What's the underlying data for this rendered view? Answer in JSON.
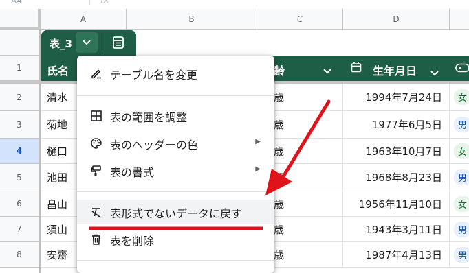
{
  "formula_bar": {
    "cell_ref": "A4",
    "fx": "fx"
  },
  "columns": [
    "A",
    "B",
    "C",
    "D",
    ""
  ],
  "rows": [
    "1",
    "2",
    "3",
    "4",
    "5",
    "6",
    "7",
    "8"
  ],
  "selected_row": "4",
  "table": {
    "name": "表_3",
    "headers": {
      "name": "氏名",
      "age": "齢",
      "birthday": "生年月日"
    },
    "data": [
      {
        "name": "清水 ",
        "age": "歳",
        "birthday": "1994年7月24日",
        "gender": "女",
        "gender_type": "f"
      },
      {
        "name": "菊地 ",
        "age": "歳",
        "birthday": "1977年6月5日",
        "gender": "男",
        "gender_type": "m"
      },
      {
        "name": "樋口 ",
        "age": "歳",
        "birthday": "1963年10月7日",
        "gender": "女",
        "gender_type": "f"
      },
      {
        "name": "池田 ",
        "age": "歳",
        "birthday": "1968年8月23日",
        "gender": "男",
        "gender_type": "m"
      },
      {
        "name": "畠山 ",
        "age": "歳",
        "birthday": "1956年11月10日",
        "gender": "女",
        "gender_type": "f"
      },
      {
        "name": "須山 ",
        "age": "歳",
        "birthday": "1943年3月11日",
        "gender": "男",
        "gender_type": "m"
      },
      {
        "name": "安齋 ",
        "age": "歳",
        "birthday": "1987年4月13日",
        "gender": "男",
        "gender_type": "m"
      }
    ]
  },
  "menu": {
    "rename": "テーブル名を変更",
    "adjust_range": "表の範囲を調整",
    "header_color": "表のヘッダーの色",
    "format": "表の書式",
    "revert": "表形式でないデータに戻す",
    "delete": "表を削除"
  },
  "colors": {
    "table_green": "#1e5e46",
    "annotation_red": "#e0131a",
    "selected_row": "#d3e3fd"
  }
}
